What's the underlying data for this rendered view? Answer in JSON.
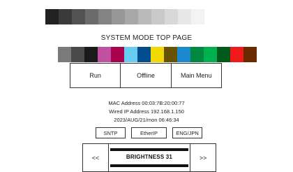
{
  "screen": {
    "title": "SYSTEM MODE TOP PAGE"
  },
  "gray_scale": [
    "#222222",
    "#3a3a3a",
    "#535353",
    "#6b6b6b",
    "#838383",
    "#979797",
    "#a8a8a8",
    "#b9b9b9",
    "#c9c9c9",
    "#d8d8d8",
    "#e7e7e7",
    "#f3f3f3"
  ],
  "color_bar": [
    "#7a7a7a",
    "#4a4a4a",
    "#1a1a1a",
    "#c050a0",
    "#a8004c",
    "#66ccf0",
    "#004c8c",
    "#f0d800",
    "#665200",
    "#1b88d0",
    "#008840",
    "#00b04c",
    "#005a1a",
    "#f01a1a",
    "#6a2a00"
  ],
  "mode_buttons": [
    {
      "label": "Run"
    },
    {
      "label": "Offline"
    },
    {
      "label": "Main Menu"
    }
  ],
  "device_info": {
    "mac": "MAC Address  00:03:7B:20:00:77",
    "ip": "Wired IP Address  192.168.1.150",
    "datetime": "2023/AUG/21/mon 06:46:34"
  },
  "settings_buttons": {
    "sntp": "SNTP",
    "etherip": "EtherIP",
    "language": "ENG/JPN"
  },
  "brightness": {
    "label": "BRIGHTNESS 31",
    "decrease": "<<",
    "increase": ">>"
  }
}
